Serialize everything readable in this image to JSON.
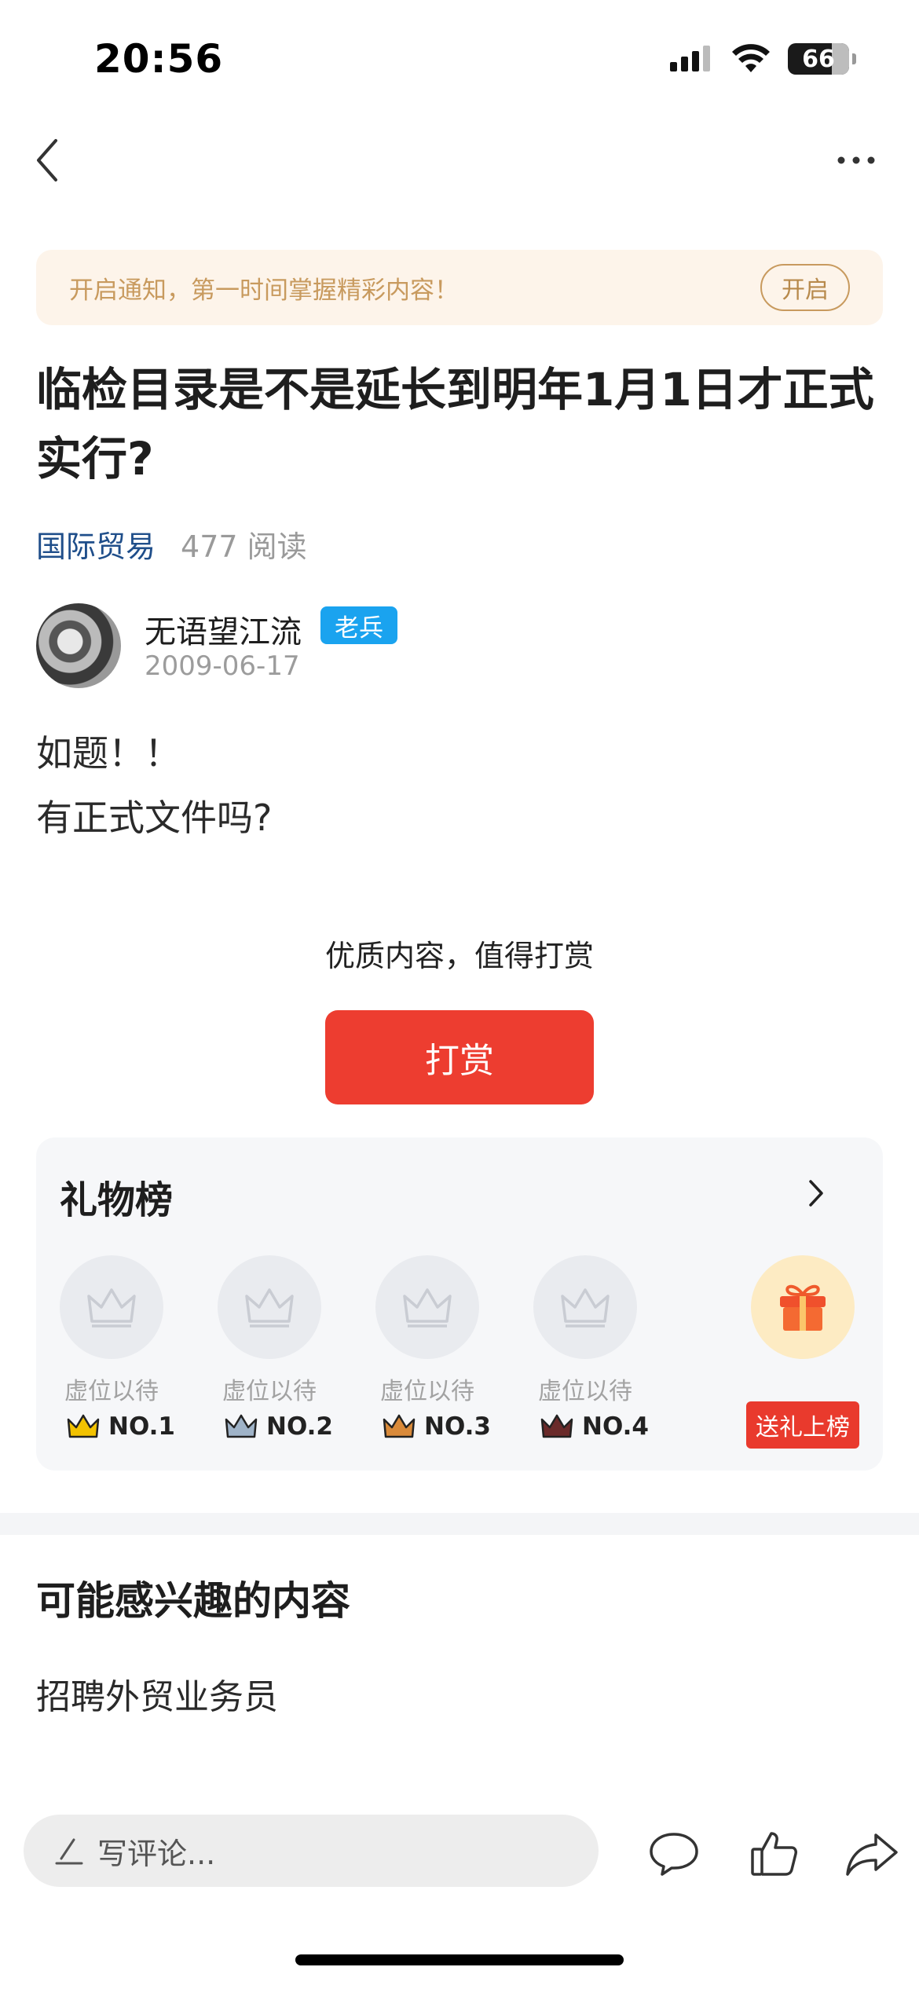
{
  "status_bar": {
    "time": "20:56",
    "battery": "66"
  },
  "notify": {
    "text": "开启通知，第一时间掌握精彩内容！",
    "button": "开启"
  },
  "post": {
    "title": "临检目录是不是延长到明年1月1日才正式实行?",
    "category": "国际贸易",
    "reads": "477 阅读",
    "author": {
      "name": "无语望江流",
      "badge": "老兵",
      "date": "2009-06-17"
    },
    "body_lines": [
      "如题！！",
      "有正式文件吗?"
    ]
  },
  "reward": {
    "prompt": "优质内容，值得打赏",
    "button": "打赏"
  },
  "gift_board": {
    "title": "礼物榜",
    "slots": [
      {
        "label": "虚位以待",
        "rank": "NO.1",
        "crown_color": "#f2c200"
      },
      {
        "label": "虚位以待",
        "rank": "NO.2",
        "crown_color": "#9fb3c8"
      },
      {
        "label": "虚位以待",
        "rank": "NO.3",
        "crown_color": "#d98a3a"
      },
      {
        "label": "虚位以待",
        "rank": "NO.4",
        "crown_color": "#6a2a2a"
      }
    ],
    "send_button": "送礼上榜"
  },
  "related": {
    "title": "可能感兴趣的内容",
    "items": [
      "招聘外贸业务员"
    ]
  },
  "bottom_bar": {
    "comment_placeholder": "写评论..."
  },
  "icons": [
    "back-icon",
    "more-icon",
    "chevron-right-icon",
    "crown-icon",
    "gift-icon",
    "comment-icon",
    "like-icon",
    "share-icon",
    "pen-icon",
    "signal-icon",
    "wifi-icon",
    "battery-icon"
  ]
}
